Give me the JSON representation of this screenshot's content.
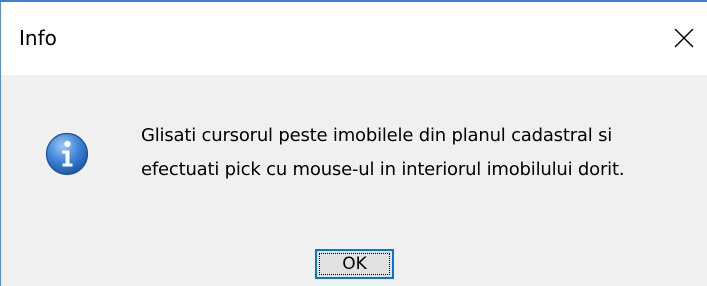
{
  "window": {
    "title": "Info",
    "close_icon": "close-icon"
  },
  "message": {
    "icon": "info-icon",
    "line1": "Glisati cursorul peste imobilele din planul cadastral si",
    "line2": "efectuati pick cu mouse-ul in interiorul imobilului dorit."
  },
  "buttons": {
    "ok_label": "OK"
  },
  "colors": {
    "window_border": "#3c7fd4",
    "content_bg": "#f0f0f0",
    "button_focus": "#0078d7",
    "icon_blue": "#2d6fc7"
  }
}
